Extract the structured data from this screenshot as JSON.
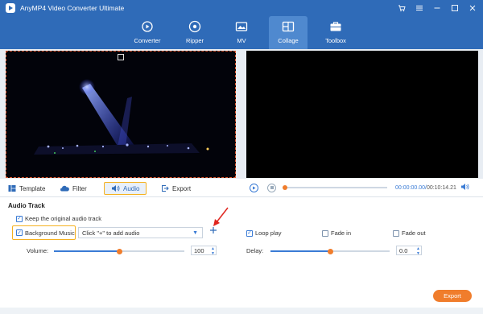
{
  "window": {
    "title": "AnyMP4 Video Converter Ultimate",
    "brand_color": "#2f6bb8",
    "accent_color": "#f07d2c",
    "highlight_color": "#f5b120"
  },
  "nav": {
    "tabs": [
      {
        "label": "Converter",
        "icon": "converter-icon"
      },
      {
        "label": "Ripper",
        "icon": "ripper-icon"
      },
      {
        "label": "MV",
        "icon": "mv-icon"
      },
      {
        "label": "Collage",
        "icon": "collage-icon",
        "active": true
      },
      {
        "label": "Toolbox",
        "icon": "toolbox-icon"
      }
    ]
  },
  "editor_tabs": [
    {
      "label": "Template",
      "icon": "template-icon"
    },
    {
      "label": "Filter",
      "icon": "filter-icon"
    },
    {
      "label": "Audio",
      "icon": "audio-icon",
      "active": true
    },
    {
      "label": "Export",
      "icon": "export-icon"
    }
  ],
  "player": {
    "current_time": "00:00:00.00",
    "total_time": "00:10:14.21",
    "progress": 0
  },
  "audio": {
    "section_title": "Audio Track",
    "keep_original_label": "Keep the original audio track",
    "keep_original_checked": true,
    "background_music_label": "Background Music",
    "background_music_checked": true,
    "dropdown_value": "Click \"+\" to add audio",
    "loop_play_label": "Loop play",
    "loop_play_checked": true,
    "fade_in_label": "Fade in",
    "fade_in_checked": false,
    "fade_out_label": "Fade out",
    "fade_out_checked": false,
    "volume_label": "Volume:",
    "volume_value": "100",
    "volume_level": 0.5,
    "delay_label": "Delay:",
    "delay_value": "0.0",
    "delay_level": 0.5
  },
  "export_button": "Export"
}
